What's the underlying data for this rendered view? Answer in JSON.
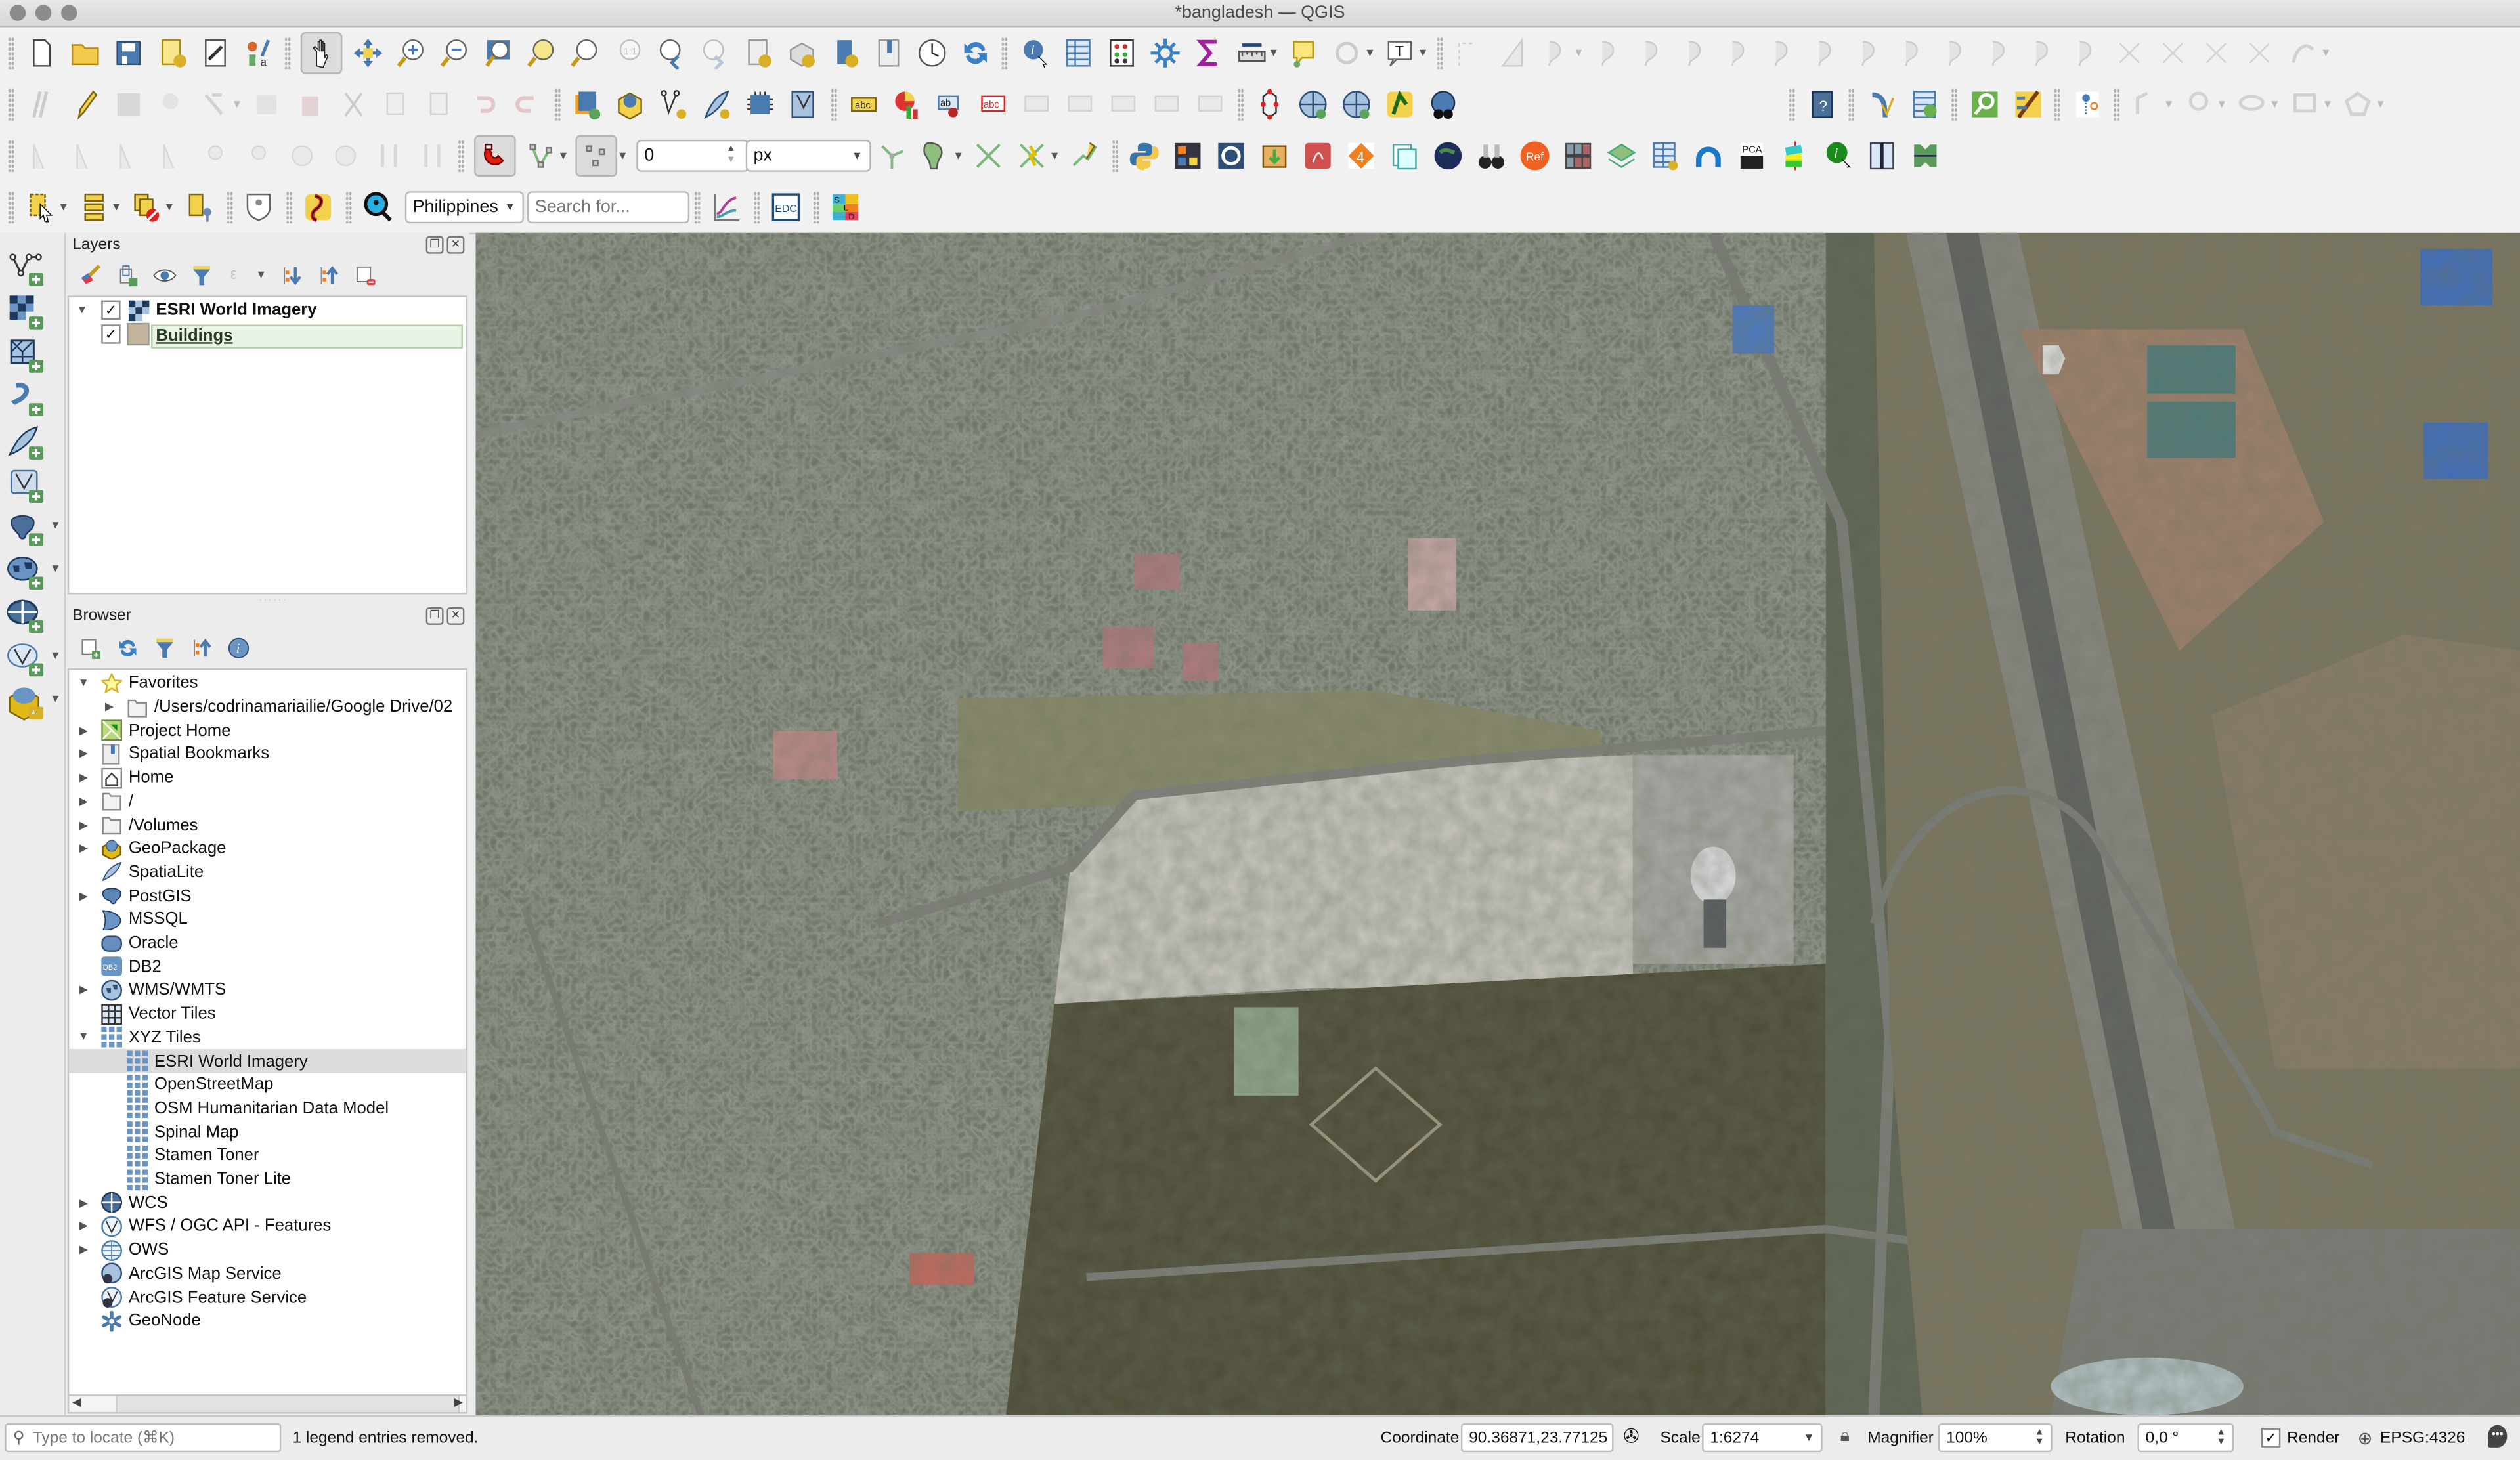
{
  "window": {
    "title": "*bangladesh — QGIS"
  },
  "toolbars": {
    "file": [
      "new-project",
      "open-project",
      "save-project",
      "new-print-layout",
      "layout-manager",
      "style-manager"
    ],
    "navigation": [
      "pan",
      "pan-to-selection",
      "zoom-in",
      "zoom-out",
      "zoom-full",
      "zoom-to-selection",
      "zoom-to-layer",
      "zoom-native",
      "zoom-last",
      "zoom-next",
      "new-map-view",
      "new-3d-view",
      "new-bookmark",
      "show-bookmarks",
      "temporal-controller",
      "refresh"
    ],
    "attributes": [
      "identify",
      "open-attribute-table",
      "field-calculator",
      "processing-toolbox",
      "statistics",
      "measure",
      "map-tips",
      "select-by-expression",
      "text-annotation"
    ],
    "snapping": {
      "tolerance_value": "0",
      "tolerance_unit": "px"
    },
    "geocoder": {
      "country": "Philippines",
      "search_placeholder": "Search for..."
    },
    "edc_label": "EDC",
    "sld_label": "SLD",
    "pca_label": "PCA",
    "ref_label": "Ref"
  },
  "layers_panel": {
    "title": "Layers",
    "layers": [
      {
        "name": "ESRI World Imagery",
        "checked": true,
        "type": "raster"
      },
      {
        "name": "Buildings",
        "checked": true,
        "type": "polygon",
        "color": "#c2b59b",
        "selected": true
      }
    ]
  },
  "browser_panel": {
    "title": "Browser",
    "items": [
      {
        "label": "Favorites",
        "icon": "star-icon",
        "expanded": true,
        "level": 0
      },
      {
        "label": "/Users/codrinamariailie/Google Drive/02",
        "icon": "folder-icon",
        "expandable": true,
        "level": 1
      },
      {
        "label": "Project Home",
        "icon": "project-home-icon",
        "expandable": true,
        "level": 0
      },
      {
        "label": "Spatial Bookmarks",
        "icon": "bookmark-icon",
        "expandable": true,
        "level": 0
      },
      {
        "label": "Home",
        "icon": "home-icon",
        "expandable": true,
        "level": 0
      },
      {
        "label": "/",
        "icon": "folder-icon",
        "expandable": true,
        "level": 0
      },
      {
        "label": "/Volumes",
        "icon": "folder-icon",
        "expandable": true,
        "level": 0
      },
      {
        "label": "GeoPackage",
        "icon": "geopackage-icon",
        "expandable": true,
        "level": 0
      },
      {
        "label": "SpatiaLite",
        "icon": "feather-icon",
        "level": 0
      },
      {
        "label": "PostGIS",
        "icon": "elephant-icon",
        "expandable": true,
        "level": 0
      },
      {
        "label": "MSSQL",
        "icon": "mssql-icon",
        "level": 0
      },
      {
        "label": "Oracle",
        "icon": "oracle-icon",
        "level": 0
      },
      {
        "label": "DB2",
        "icon": "db2-icon",
        "level": 0
      },
      {
        "label": "WMS/WMTS",
        "icon": "globe-icon",
        "expandable": true,
        "level": 0
      },
      {
        "label": "Vector Tiles",
        "icon": "vector-tiles-icon",
        "level": 0
      },
      {
        "label": "XYZ Tiles",
        "icon": "xyz-tiles-icon",
        "expanded": true,
        "level": 0
      },
      {
        "label": "ESRI World Imagery",
        "icon": "xyz-tile-icon",
        "level": 1,
        "selected": true
      },
      {
        "label": "OpenStreetMap",
        "icon": "xyz-tile-icon",
        "level": 1
      },
      {
        "label": "OSM Humanitarian Data Model",
        "icon": "xyz-tile-icon",
        "level": 1
      },
      {
        "label": "Spinal Map",
        "icon": "xyz-tile-icon",
        "level": 1
      },
      {
        "label": "Stamen Toner",
        "icon": "xyz-tile-icon",
        "level": 1
      },
      {
        "label": "Stamen Toner Lite",
        "icon": "xyz-tile-icon",
        "level": 1
      },
      {
        "label": "WCS",
        "icon": "wcs-icon",
        "expandable": true,
        "level": 0
      },
      {
        "label": "WFS / OGC API - Features",
        "icon": "wfs-icon",
        "expandable": true,
        "level": 0
      },
      {
        "label": "OWS",
        "icon": "ows-icon",
        "expandable": true,
        "level": 0
      },
      {
        "label": "ArcGIS Map Service",
        "icon": "arcgis-map-icon",
        "level": 0
      },
      {
        "label": "ArcGIS Feature Service",
        "icon": "arcgis-feature-icon",
        "level": 0
      },
      {
        "label": "GeoNode",
        "icon": "geonode-icon",
        "level": 0
      }
    ]
  },
  "statusbar": {
    "locator_placeholder": "Type to locate (⌘K)",
    "message": "1 legend entries removed.",
    "coordinate_label": "Coordinate",
    "coordinate_value": "90.36871,23.77125",
    "scale_label": "Scale",
    "scale_value": "1:6274",
    "magnifier_label": "Magnifier",
    "magnifier_value": "100%",
    "rotation_label": "Rotation",
    "rotation_value": "0,0 °",
    "render_label": "Render",
    "render_checked": true,
    "crs": "EPSG:4326"
  },
  "colors": {
    "accent_blue": "#4a7bb0",
    "selection_green": "#e6f2e3",
    "buildings_fill": "#c2b59b"
  }
}
